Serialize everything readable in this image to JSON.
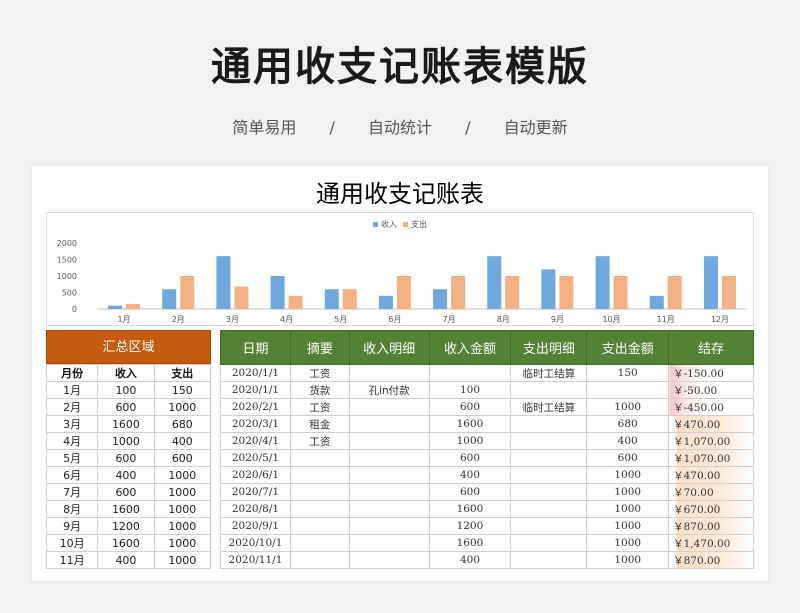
{
  "hero_title": "通用收支记账表模版",
  "subtitle": [
    "简单易用",
    "/",
    "自动统计",
    "/",
    "自动更新"
  ],
  "sheet_title": "通用收支记账表",
  "chart_data": {
    "type": "bar",
    "categories": [
      "1月",
      "2月",
      "3月",
      "4月",
      "5月",
      "6月",
      "7月",
      "8月",
      "9月",
      "10月",
      "11月",
      "12月"
    ],
    "series": [
      {
        "name": "收入",
        "color": "#6fa8dc",
        "values": [
          100,
          600,
          1600,
          1000,
          600,
          400,
          600,
          1600,
          1200,
          1600,
          400,
          1600
        ]
      },
      {
        "name": "支出",
        "color": "#f4b183",
        "values": [
          150,
          1000,
          680,
          400,
          600,
          1000,
          1000,
          1000,
          1000,
          1000,
          1000,
          1000
        ]
      }
    ],
    "yticks": [
      "0",
      "500",
      "1000",
      "1500",
      "2000"
    ],
    "ylim": [
      0,
      2000
    ],
    "legend": "top-center"
  },
  "summary": {
    "header": "汇总区域",
    "columns": [
      "月份",
      "收入",
      "支出"
    ],
    "rows": [
      [
        "1月",
        "100",
        "150"
      ],
      [
        "2月",
        "600",
        "1000"
      ],
      [
        "3月",
        "1600",
        "680"
      ],
      [
        "4月",
        "1000",
        "400"
      ],
      [
        "5月",
        "600",
        "600"
      ],
      [
        "6月",
        "400",
        "1000"
      ],
      [
        "7月",
        "600",
        "1000"
      ],
      [
        "8月",
        "1600",
        "1000"
      ],
      [
        "9月",
        "1200",
        "1000"
      ],
      [
        "10月",
        "1600",
        "1000"
      ],
      [
        "11月",
        "400",
        "1000"
      ]
    ]
  },
  "main": {
    "columns": [
      "日期",
      "摘要",
      "收入明细",
      "收入金额",
      "支出明细",
      "支出金额",
      "结存"
    ],
    "rows": [
      [
        "2020/1/1",
        "工资",
        "",
        "",
        "临时工结算",
        "150",
        "￥-150.00"
      ],
      [
        "2020/1/1",
        "货款",
        "孔in付款",
        "100",
        "",
        "",
        "￥-50.00"
      ],
      [
        "2020/2/1",
        "工资",
        "",
        "600",
        "临时工结算",
        "1000",
        "￥-450.00"
      ],
      [
        "2020/3/1",
        "租金",
        "",
        "1600",
        "",
        "680",
        "￥470.00"
      ],
      [
        "2020/4/1",
        "工资",
        "",
        "1000",
        "",
        "400",
        "￥1,070.00"
      ],
      [
        "2020/5/1",
        "",
        "",
        "600",
        "",
        "600",
        "￥1,070.00"
      ],
      [
        "2020/6/1",
        "",
        "",
        "400",
        "",
        "1000",
        "￥470.00"
      ],
      [
        "2020/7/1",
        "",
        "",
        "600",
        "",
        "1000",
        "￥70.00"
      ],
      [
        "2020/8/1",
        "",
        "",
        "1600",
        "",
        "1000",
        "￥670.00"
      ],
      [
        "2020/9/1",
        "",
        "",
        "1200",
        "",
        "1000",
        "￥870.00"
      ],
      [
        "2020/10/1",
        "",
        "",
        "1600",
        "",
        "1000",
        "￥1,470.00"
      ],
      [
        "2020/11/1",
        "",
        "",
        "400",
        "",
        "1000",
        "￥870.00"
      ]
    ],
    "balance_values": [
      -150,
      -50,
      -450,
      470,
      1070,
      1070,
      470,
      70,
      670,
      870,
      1470,
      870
    ]
  }
}
